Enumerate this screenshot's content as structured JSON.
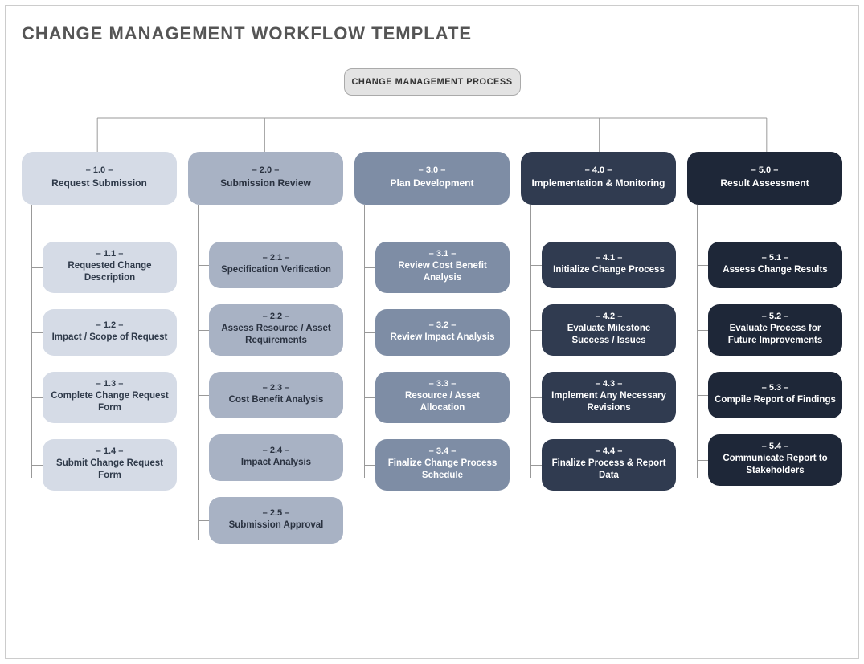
{
  "title": "CHANGE MANAGEMENT WORKFLOW TEMPLATE",
  "root": "CHANGE MANAGEMENT PROCESS",
  "columns": [
    {
      "num": "– 1.0 –",
      "label": "Request Submission",
      "subs": [
        {
          "num": "– 1.1 –",
          "label": "Requested Change Description"
        },
        {
          "num": "– 1.2 –",
          "label": "Impact / Scope of Request"
        },
        {
          "num": "– 1.3 –",
          "label": "Complete Change Request Form"
        },
        {
          "num": "– 1.4 –",
          "label": "Submit Change Request Form"
        }
      ]
    },
    {
      "num": "– 2.0 –",
      "label": "Submission Review",
      "subs": [
        {
          "num": "– 2.1 –",
          "label": "Specification Verification"
        },
        {
          "num": "– 2.2 –",
          "label": "Assess Resource / Asset Requirements"
        },
        {
          "num": "– 2.3 –",
          "label": "Cost Benefit Analysis"
        },
        {
          "num": "– 2.4 –",
          "label": "Impact Analysis"
        },
        {
          "num": "– 2.5 –",
          "label": "Submission Approval"
        }
      ]
    },
    {
      "num": "– 3.0 –",
      "label": "Plan Development",
      "subs": [
        {
          "num": "– 3.1 –",
          "label": "Review Cost Benefit Analysis"
        },
        {
          "num": "– 3.2 –",
          "label": "Review Impact Analysis"
        },
        {
          "num": "– 3.3 –",
          "label": "Resource / Asset Allocation"
        },
        {
          "num": "– 3.4 –",
          "label": "Finalize Change Process Schedule"
        }
      ]
    },
    {
      "num": "– 4.0 –",
      "label": "Implementation & Monitoring",
      "subs": [
        {
          "num": "– 4.1 –",
          "label": "Initialize Change Process"
        },
        {
          "num": "– 4.2 –",
          "label": "Evaluate Milestone Success / Issues"
        },
        {
          "num": "– 4.3 –",
          "label": "Implement Any Necessary Revisions"
        },
        {
          "num": "– 4.4 –",
          "label": "Finalize Process & Report Data"
        }
      ]
    },
    {
      "num": "– 5.0 –",
      "label": "Result Assessment",
      "subs": [
        {
          "num": "– 5.1 –",
          "label": "Assess Change Results"
        },
        {
          "num": "– 5.2 –",
          "label": "Evaluate Process for Future Improvements"
        },
        {
          "num": "– 5.3 –",
          "label": "Compile Report of Findings"
        },
        {
          "num": "– 5.4 –",
          "label": "Communicate Report to Stakeholders"
        }
      ]
    }
  ]
}
